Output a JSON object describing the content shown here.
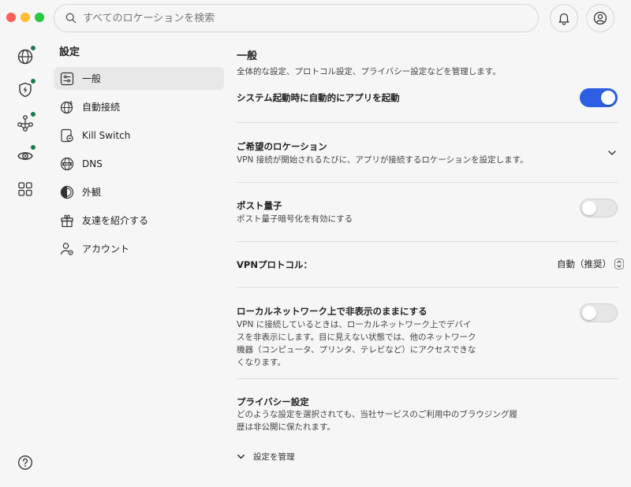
{
  "search": {
    "placeholder": "すべてのロケーションを検索"
  },
  "rail": {
    "items": [
      {
        "icon": "globe-icon",
        "badge": true
      },
      {
        "icon": "shield-bolt-icon",
        "badge": true
      },
      {
        "icon": "meshnet-icon",
        "badge": true
      },
      {
        "icon": "eye-icon",
        "badge": true
      },
      {
        "icon": "grid-icon",
        "badge": false
      }
    ],
    "help_icon": "help-icon"
  },
  "nav": {
    "title": "設定",
    "items": [
      {
        "label": "一般",
        "icon": "sliders-icon",
        "active": true
      },
      {
        "label": "自動接続",
        "icon": "auto-connect-icon",
        "active": false
      },
      {
        "label": "Kill Switch",
        "icon": "kill-switch-icon",
        "active": false
      },
      {
        "label": "DNS",
        "icon": "dns-icon",
        "active": false
      },
      {
        "label": "外観",
        "icon": "appearance-icon",
        "active": false
      },
      {
        "label": "友達を紹介する",
        "icon": "gift-icon",
        "active": false
      },
      {
        "label": "アカウント",
        "icon": "account-icon",
        "active": false
      }
    ]
  },
  "main": {
    "title": "一般",
    "subtitle": "全体的な設定、プロトコル設定、プライバシー設定などを管理します。",
    "launch_at_startup": {
      "label": "システム起動時に自動的にアプリを起動",
      "enabled": true
    },
    "preferred_location": {
      "label": "ご希望のロケーション",
      "desc": "VPN 接続が開始されるたびに、アプリが接続するロケーションを設定します。"
    },
    "post_quantum": {
      "label": "ポスト量子",
      "desc": "ポスト量子暗号化を有効にする",
      "enabled": false
    },
    "vpn_protocol": {
      "label": "VPNプロトコル：",
      "value": "自動（推奨）"
    },
    "local_network": {
      "label": "ローカルネットワーク上で非表示のままにする",
      "desc_lines": [
        "VPN に接続しているときは、ローカルネットワーク上でデバイ",
        "スを非表示にします。目に見えない状態では、他のネットワーク",
        "機器（コンピュータ、プリンタ、テレビなど）にアクセスできな",
        "くなります。"
      ],
      "enabled": false
    },
    "privacy": {
      "label": "プライバシー設定",
      "desc_lines": [
        "どのような設定を選択されても、当社サービスのご利用中のブラウジング履",
        "歴は非公開に保たれます。"
      ],
      "manage_label": "設定を管理"
    }
  },
  "colors": {
    "accent": "#2c5fe3",
    "badge": "#1a7a4c",
    "background": "#f6f6f6"
  }
}
